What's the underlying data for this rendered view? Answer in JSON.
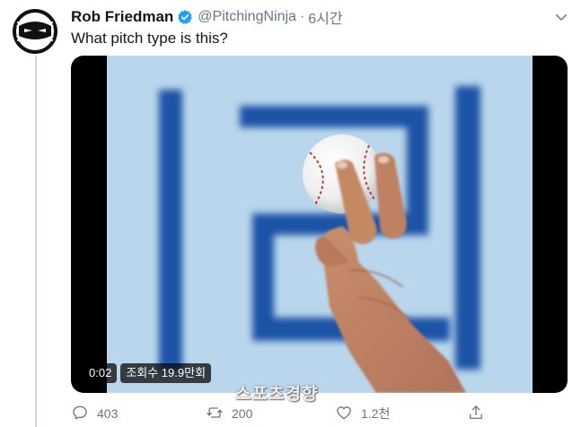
{
  "tweet": {
    "author_name": "Rob Friedman",
    "handle": "@PitchingNinja",
    "separator": "·",
    "time": "6시간",
    "text": "What pitch type is this?",
    "avatar_icon": "ninja-baseball-avatar",
    "verified_icon": "verified-badge-icon",
    "caret_icon": "chevron-down-icon"
  },
  "video": {
    "timestamp": "0:02",
    "views": "조회수 19.9만회",
    "board_text": "|리",
    "colors": {
      "background": "#b9d6ec",
      "lettering": "#1e52a6",
      "side_bars": "#000000"
    }
  },
  "watermark": "스포츠경향",
  "actions": {
    "reply": {
      "icon": "reply-icon",
      "count": "403"
    },
    "retweet": {
      "icon": "retweet-icon",
      "count": "200"
    },
    "like": {
      "icon": "heart-icon",
      "count": "1.2천"
    },
    "share": {
      "icon": "share-icon",
      "count": ""
    }
  },
  "colors": {
    "text_primary": "#14171a",
    "text_secondary": "#657786",
    "verified_blue": "#1da1f2",
    "thread_line": "#ccd6dd"
  }
}
